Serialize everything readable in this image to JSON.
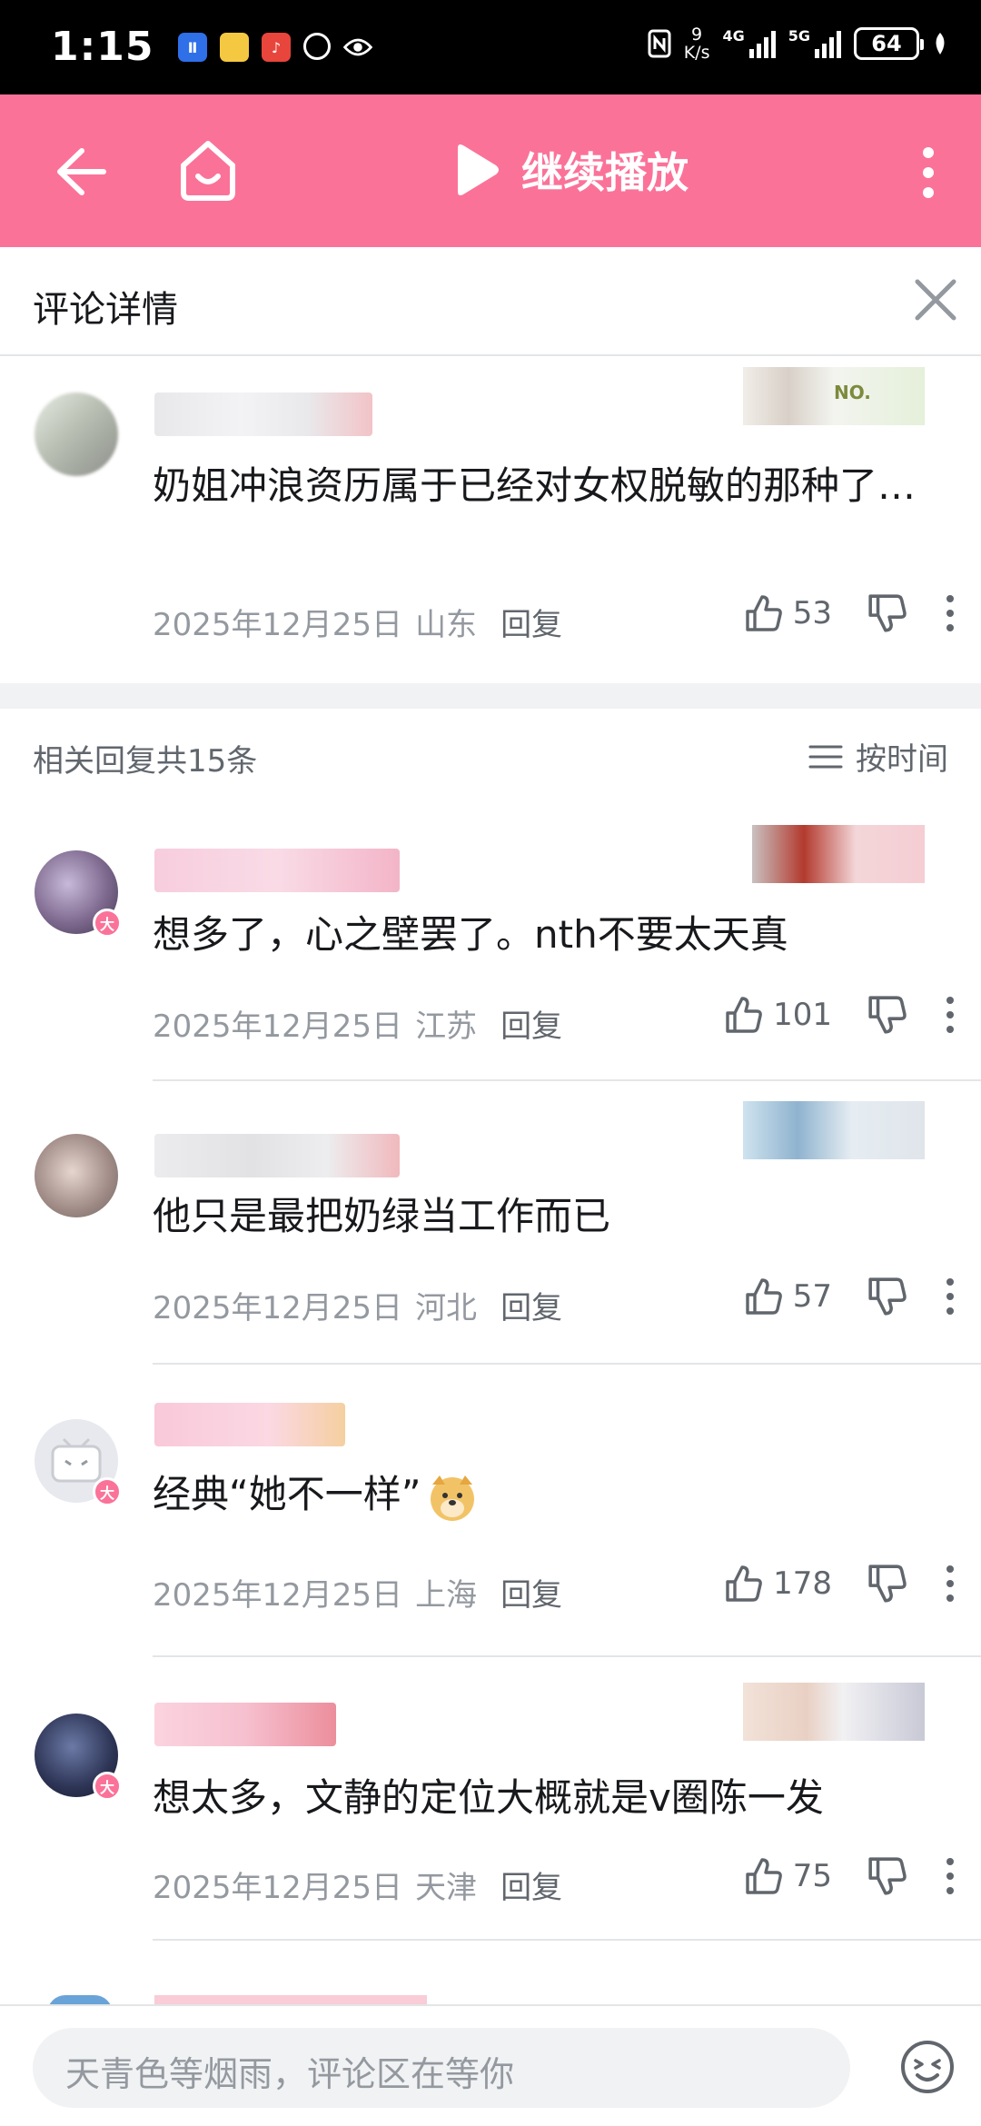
{
  "status_bar": {
    "time": "1:15",
    "net_speed_value": "9",
    "net_speed_unit": "K/s",
    "sig1_label": "4G",
    "sig2_label": "5G",
    "battery": "64"
  },
  "header": {
    "continue_label": "继续播放"
  },
  "detail": {
    "title": "评论详情"
  },
  "root_comment": {
    "text": "奶姐冲浪资历属于已经对女权脱敏的那种了…",
    "date": "2025年12月25日",
    "location": "山东",
    "reply_label": "回复",
    "likes": "53",
    "fan_badge_text": "NO."
  },
  "replies_header": {
    "count_text": "相关回复共15条",
    "sort_label": "按时间"
  },
  "replies": [
    {
      "text": "想多了，心之壁罢了。nth不要太天真",
      "date": "2025年12月25日",
      "location": "江苏",
      "reply_label": "回复",
      "likes": "101"
    },
    {
      "text": "他只是最把奶绿当工作而已",
      "date": "2025年12月25日",
      "location": "河北",
      "reply_label": "回复",
      "likes": "57"
    },
    {
      "text": "经典“她不一样”",
      "date": "2025年12月25日",
      "location": "上海",
      "reply_label": "回复",
      "likes": "178"
    },
    {
      "text": "想太多，文静的定位大概就是v圈陈一发",
      "date": "2025年12月25日",
      "location": "天津",
      "reply_label": "回复",
      "likes": "75"
    }
  ],
  "input": {
    "placeholder": "天青色等烟雨，评论区在等你"
  },
  "avatar_badge": "大",
  "colors": {
    "brand_pink": "#fb7299",
    "text_primary": "#18191c",
    "text_secondary": "#61666d",
    "text_tertiary": "#9499a0",
    "divider": "#e3e5e7"
  },
  "icons": [
    "back-arrow-icon",
    "home-icon",
    "play-icon",
    "more-vertical-icon",
    "close-icon",
    "thumbs-up-icon",
    "thumbs-down-icon",
    "sort-list-icon",
    "emoji-icon",
    "doge-emoji"
  ]
}
